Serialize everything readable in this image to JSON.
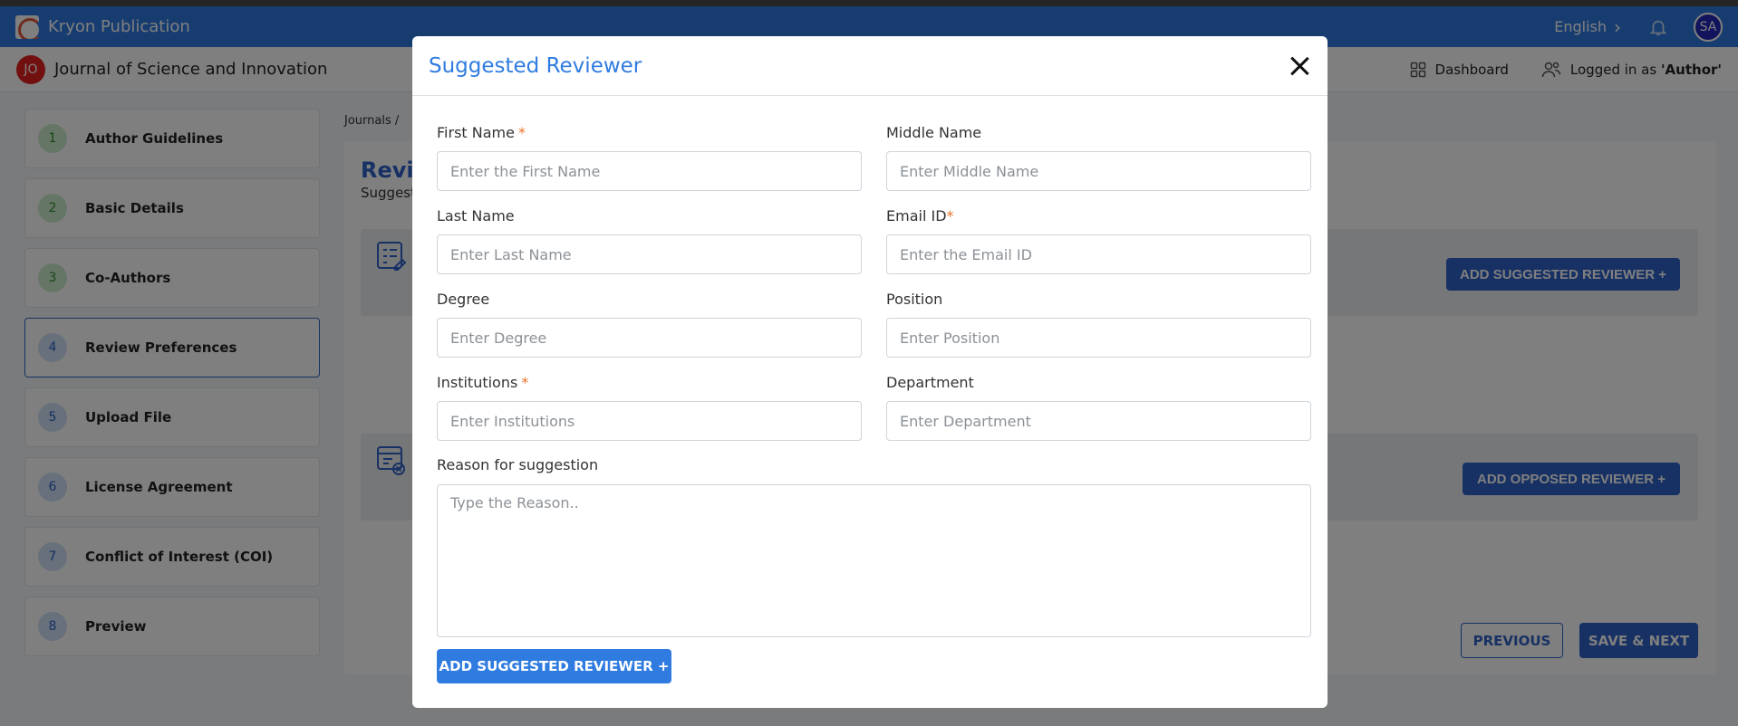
{
  "appbar": {
    "title": "Kryon Publication",
    "language": "English",
    "language_chevron": "›",
    "avatar_initials": "SA"
  },
  "journal": {
    "badge": "JO",
    "title": "Journal of Science and Innovation",
    "dashboard_label": "Dashboard",
    "logged_in_prefix": "Logged in as ",
    "logged_in_role": "'Author'"
  },
  "steps": [
    {
      "num": "1",
      "label": "Author Guidelines",
      "status": "done"
    },
    {
      "num": "2",
      "label": "Basic Details",
      "status": "done"
    },
    {
      "num": "3",
      "label": "Co-Authors",
      "status": "done"
    },
    {
      "num": "4",
      "label": "Review Preferences",
      "status": "active"
    },
    {
      "num": "5",
      "label": "Upload File",
      "status": "todo"
    },
    {
      "num": "6",
      "label": "License Agreement",
      "status": "todo"
    },
    {
      "num": "7",
      "label": "Conflict of Interest (COI)",
      "status": "todo"
    },
    {
      "num": "8",
      "label": "Preview",
      "status": "todo"
    }
  ],
  "main": {
    "breadcrumb": "Journals  /",
    "title": "Revie",
    "subtitle": "Suggest",
    "add_suggested_label": "ADD SUGGESTED REVIEWER +",
    "add_opposed_label": "ADD OPPOSED REVIEWER +",
    "previous_label": "PREVIOUS",
    "save_next_label": "SAVE & NEXT"
  },
  "modal": {
    "title": "Suggested Reviewer",
    "first_name": {
      "label": "First Name",
      "required": "*",
      "placeholder": "Enter the First Name"
    },
    "middle_name": {
      "label": "Middle Name",
      "placeholder": "Enter Middle Name"
    },
    "last_name": {
      "label": "Last Name",
      "placeholder": "Enter Last Name"
    },
    "email": {
      "label": "Email ID",
      "required": "*",
      "placeholder": "Enter the Email ID"
    },
    "degree": {
      "label": "Degree",
      "placeholder": "Enter Degree"
    },
    "position": {
      "label": "Position",
      "placeholder": "Enter Position"
    },
    "institutions": {
      "label": "Institutions",
      "required": "*",
      "placeholder": "Enter Institutions"
    },
    "department": {
      "label": "Department",
      "placeholder": "Enter Department"
    },
    "reason": {
      "label": "Reason for suggestion",
      "placeholder": "Type the Reason.."
    },
    "submit_label": "ADD SUGGESTED REVIEWER +"
  },
  "colors": {
    "primary": "#2f7be0",
    "accent": "#2f63c9",
    "required": "#e8722a",
    "badge_red": "#e41e1e"
  }
}
